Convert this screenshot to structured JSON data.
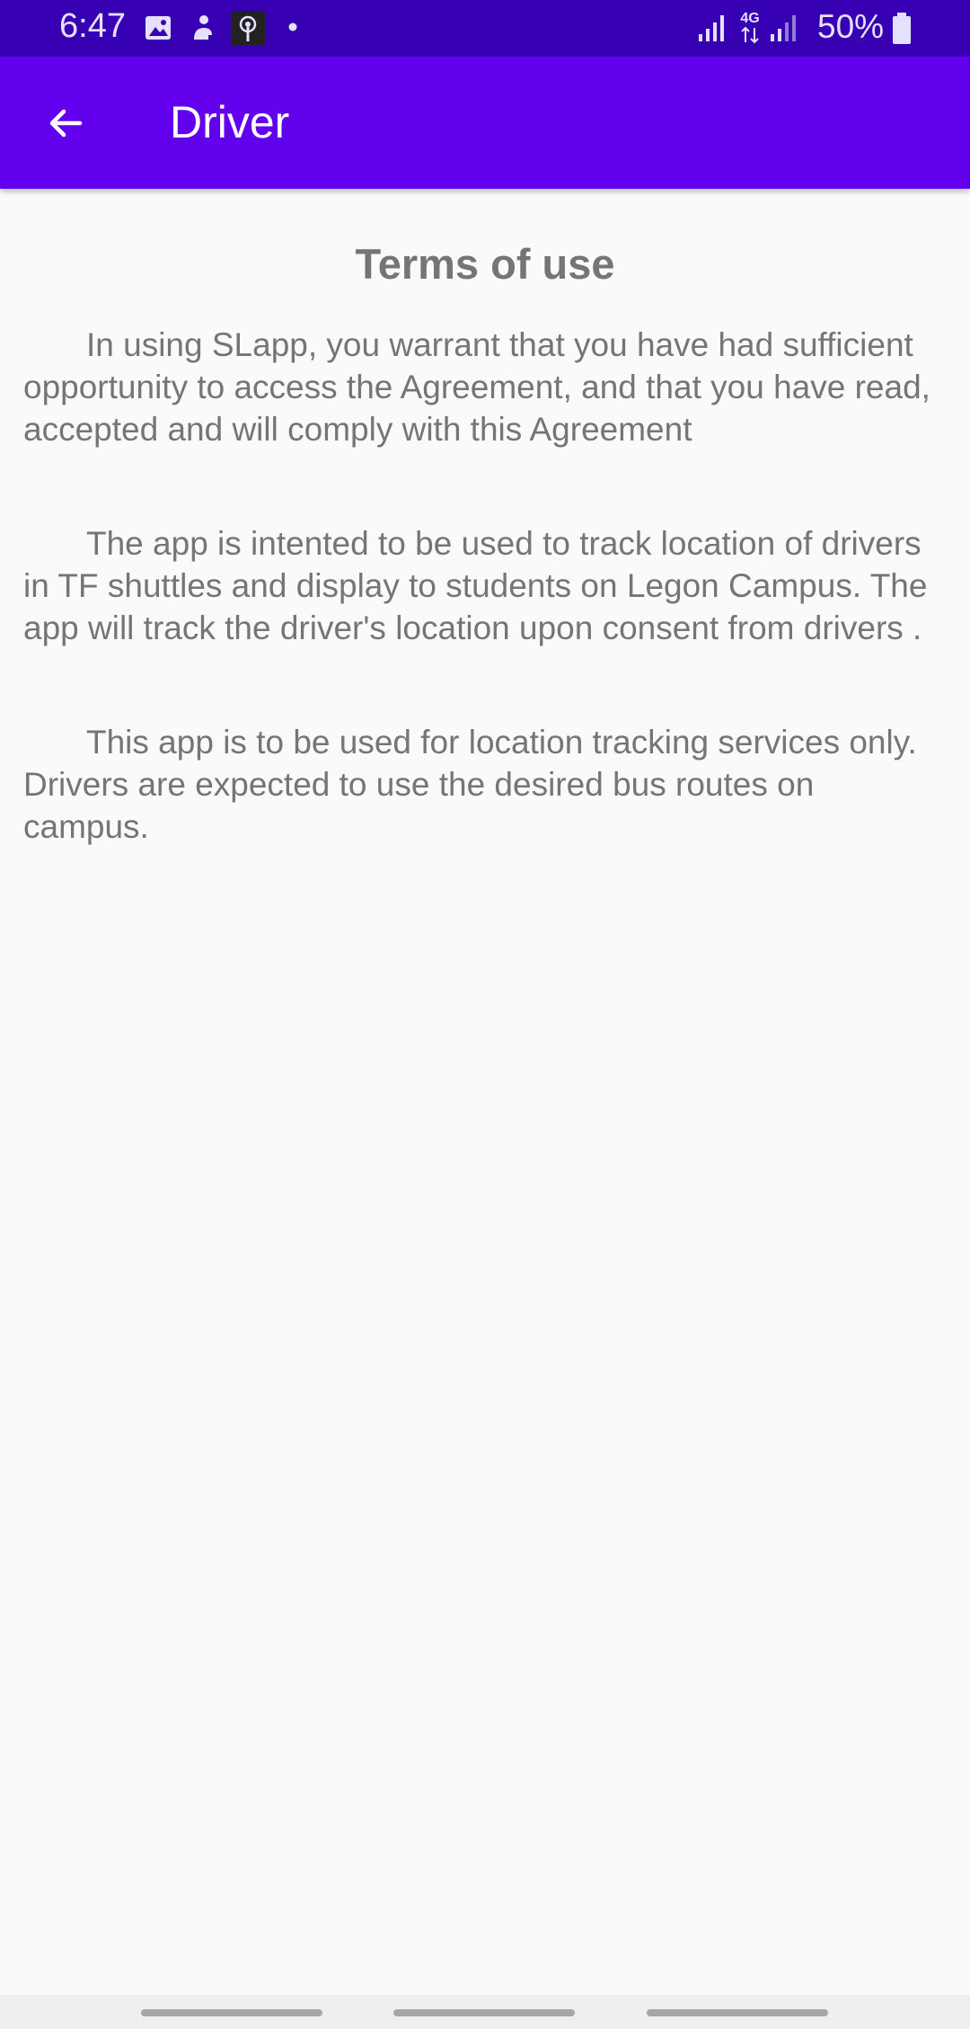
{
  "status_bar": {
    "time": "6:47",
    "battery_percent": "50%",
    "network_type": "4G",
    "icons": [
      "gallery-icon",
      "person-icon",
      "hotspot-icon",
      "notification-dot-icon",
      "signal-icon",
      "signal-icon",
      "battery-icon"
    ]
  },
  "app_bar": {
    "title": "Driver",
    "back_icon": "arrow-back-icon"
  },
  "content": {
    "heading": "Terms of use",
    "paragraphs": [
      "In using SLapp, you warrant that you have had sufficient opportunity to access the Agreement, and that you have read, accepted and will comply with this Agreement",
      "The app is intented to be used to track location of drivers in TF shuttles and display to students on Legon Campus. The app will track the driver's location upon consent from drivers .",
      "This app is to be used for location tracking services only. Drivers are expected to use the desired bus routes on campus."
    ]
  },
  "colors": {
    "status_bar": "#3700b3",
    "app_bar": "#6200ee",
    "text": "#757575",
    "background": "#fafafa"
  }
}
